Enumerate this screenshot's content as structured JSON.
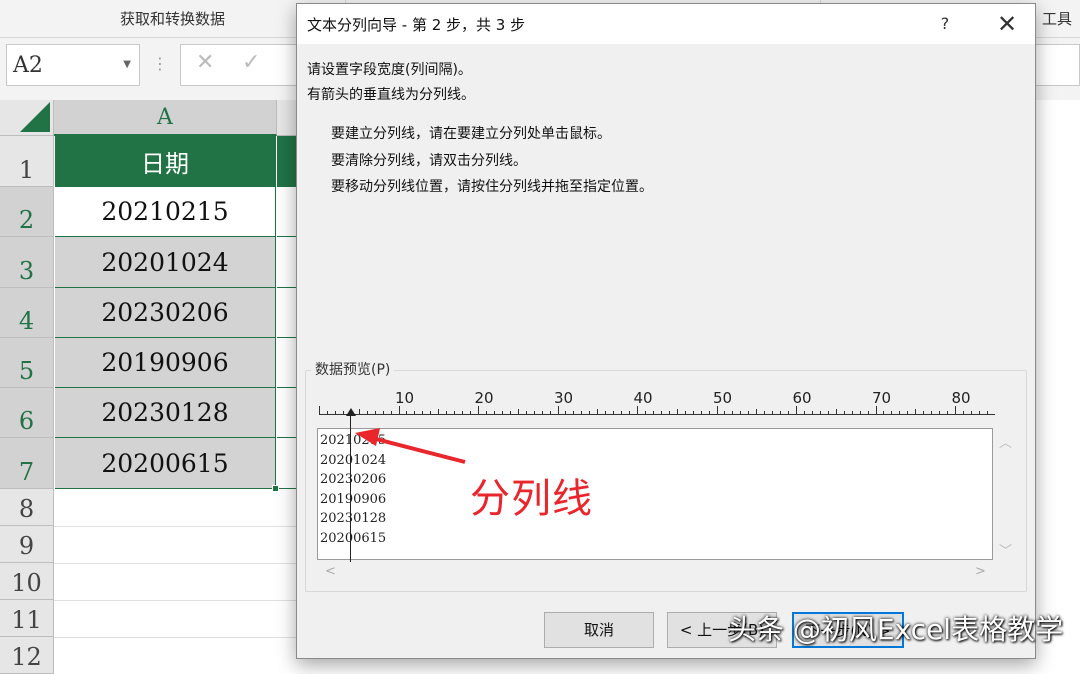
{
  "ribbon": {
    "group_label": "获取和转换数据",
    "tools_label": "工具"
  },
  "formula_bar": {
    "name_box": "A2",
    "cancel_icon": "✕",
    "enter_icon": "✓",
    "dots": "⋮"
  },
  "grid": {
    "column_header": "A",
    "rows": [
      {
        "num": "1",
        "value": "日期"
      },
      {
        "num": "2",
        "value": "20210215"
      },
      {
        "num": "3",
        "value": "20201024"
      },
      {
        "num": "4",
        "value": "20230206"
      },
      {
        "num": "5",
        "value": "20190906"
      },
      {
        "num": "6",
        "value": "20230128"
      },
      {
        "num": "7",
        "value": "20200615"
      },
      {
        "num": "8",
        "value": ""
      },
      {
        "num": "9",
        "value": ""
      },
      {
        "num": "10",
        "value": ""
      },
      {
        "num": "11",
        "value": ""
      },
      {
        "num": "12",
        "value": ""
      }
    ],
    "accent_color": "#217346"
  },
  "dialog": {
    "title": "文本分列向导 - 第 2 步，共 3 步",
    "help": "?",
    "close": "✕",
    "line1": "请设置字段宽度(列间隔)。",
    "line2": "有箭头的垂直线为分列线。",
    "bullet1": "要建立分列线，请在要建立分列处单击鼠标。",
    "bullet2": "要清除分列线，请双击分列线。",
    "bullet3": "要移动分列线位置，请按住分列线并拖至指定位置。",
    "preview_label": "数据预览(P)",
    "ruler_labels": [
      "10",
      "20",
      "30",
      "40",
      "50",
      "60",
      "70",
      "80"
    ],
    "preview_lines": [
      "20210215",
      "20201024",
      "20230206",
      "20190906",
      "20230128",
      "20200615"
    ],
    "buttons": {
      "cancel": "取消",
      "back": "< 上一步(B)",
      "next": "下一步(N) >"
    }
  },
  "annotation": {
    "label": "分列线",
    "color": "#e8262b"
  },
  "watermark": "头条 @初风Excel表格教学"
}
